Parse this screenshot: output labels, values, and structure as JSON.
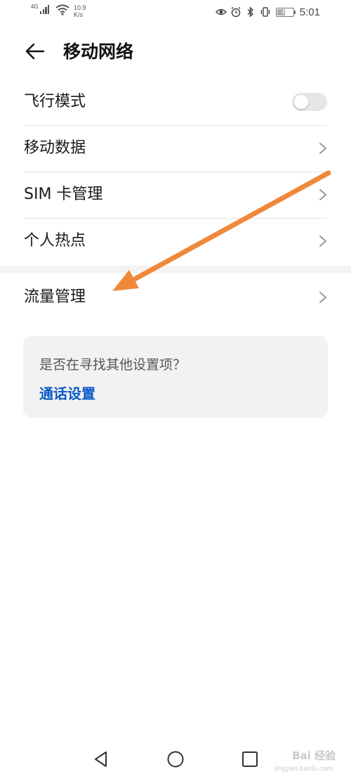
{
  "status_bar": {
    "network_type": "4G",
    "speed_value": "10.9",
    "speed_unit": "K/s",
    "battery_level": "49",
    "time": "5:01",
    "icons": [
      "signal-icon",
      "wifi-icon",
      "eye-icon",
      "alarm-icon",
      "bluetooth-icon",
      "vibrate-icon",
      "battery-icon"
    ]
  },
  "header": {
    "title": "移动网络",
    "back_icon": "arrow-left-icon"
  },
  "settings": {
    "items": [
      {
        "label": "飞行模式",
        "control": "toggle",
        "toggle_on": false
      },
      {
        "label": "移动数据",
        "control": "chevron"
      },
      {
        "label": "SIM 卡管理",
        "control": "chevron"
      },
      {
        "label": "个人热点",
        "control": "chevron"
      }
    ],
    "items2": [
      {
        "label": "流量管理",
        "control": "chevron"
      }
    ]
  },
  "suggestion": {
    "question": "是否在寻找其他设置项？",
    "link": "通话设置"
  },
  "navbar": {
    "buttons": [
      "back-triangle-icon",
      "home-circle-icon",
      "recents-square-icon"
    ]
  },
  "watermark": {
    "text": "Bai 经验",
    "sub": "jingyan.baidu.com"
  },
  "colors": {
    "link": "#0a59c8",
    "annotation_arrow": "#f0883a",
    "toggle_off": "#e6e6e6",
    "card_bg": "#f2f2f2"
  }
}
